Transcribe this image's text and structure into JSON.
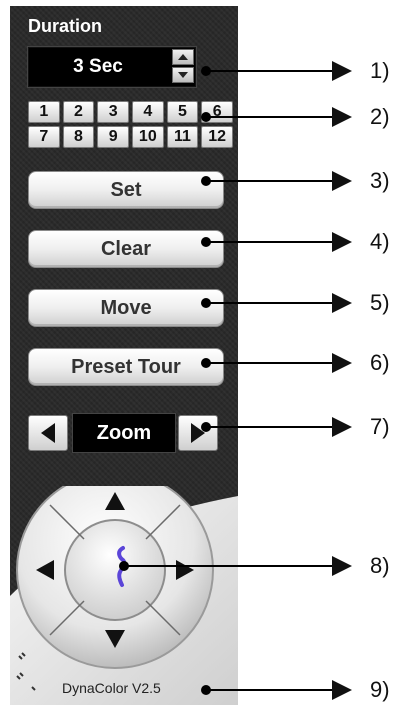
{
  "ptz": {
    "duration_label": "Duration",
    "duration_value": "3 Sec",
    "presets": [
      "1",
      "2",
      "3",
      "4",
      "5",
      "6",
      "7",
      "8",
      "9",
      "10",
      "11",
      "12"
    ],
    "buttons": {
      "set": "Set",
      "clear": "Clear",
      "move": "Move",
      "preset_tour": "Preset Tour"
    },
    "zoom_label": "Zoom",
    "version": "DynaColor V2.5"
  },
  "callouts": [
    "1)",
    "2)",
    "3)",
    "4)",
    "5)",
    "6)",
    "7)",
    "8)",
    "9)"
  ]
}
